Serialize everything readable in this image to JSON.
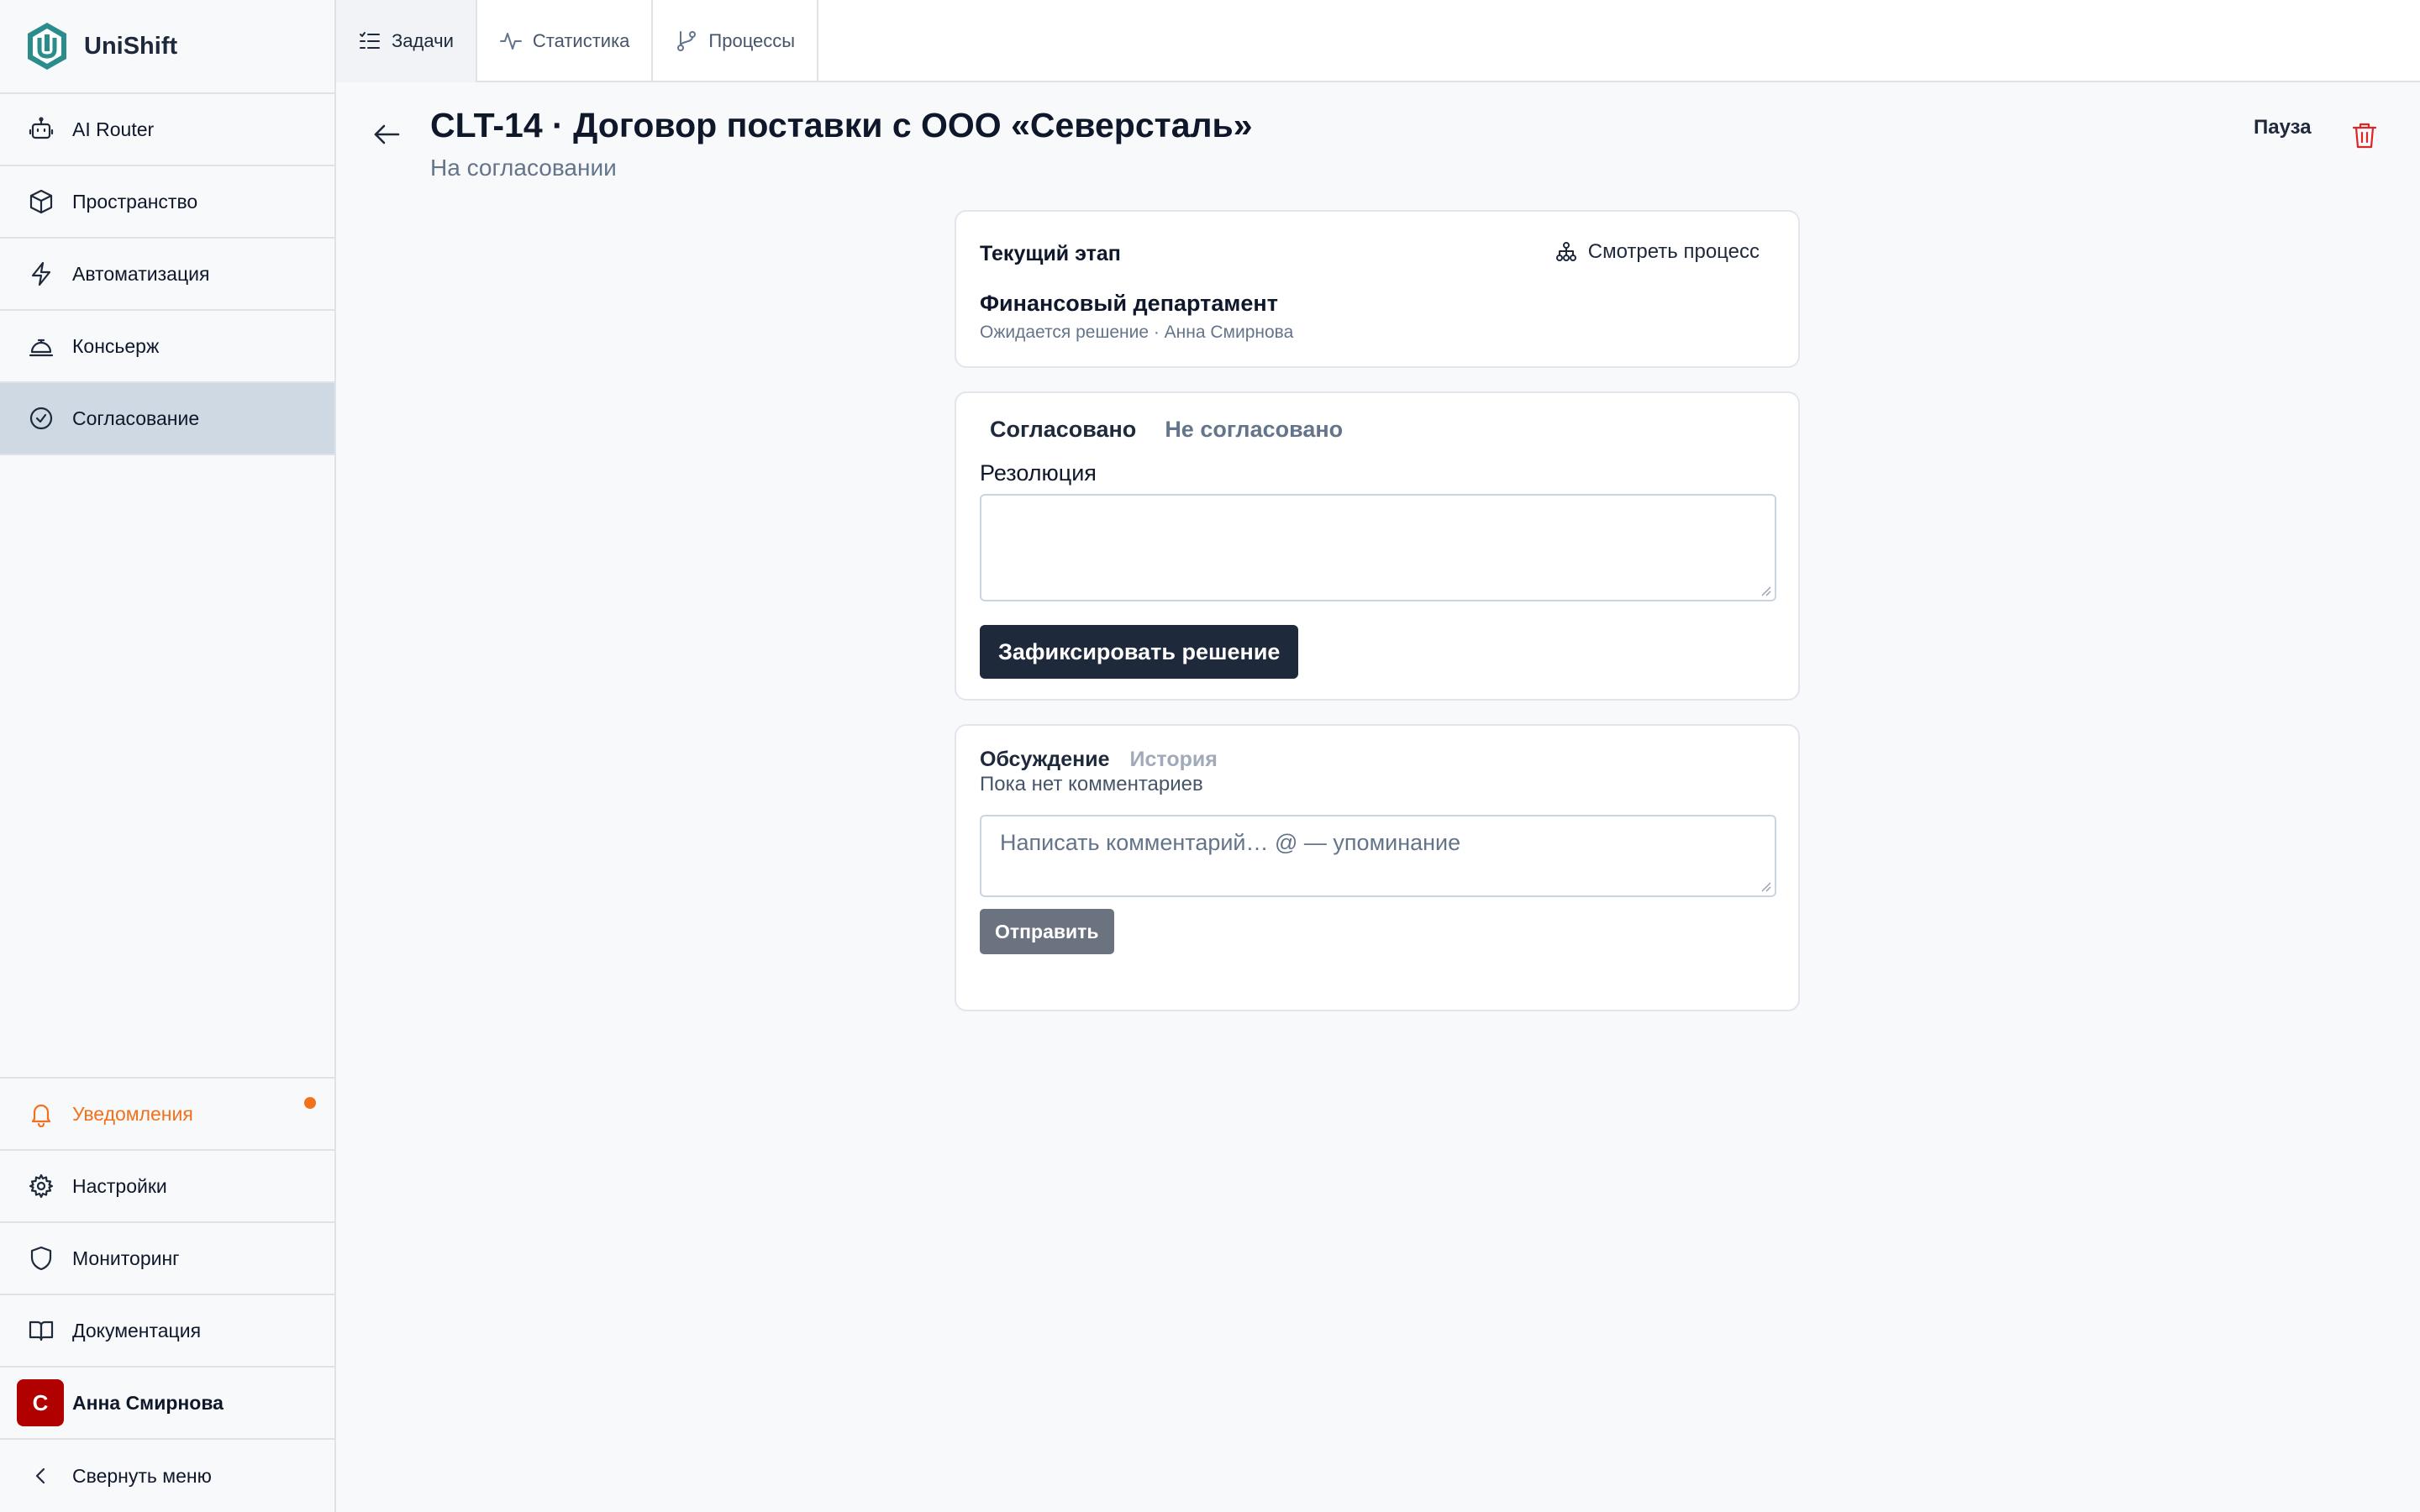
{
  "app": {
    "name": "UniShift"
  },
  "sidebar": {
    "items": [
      {
        "label": "AI Router",
        "icon": "bot-icon"
      },
      {
        "label": "Пространство",
        "icon": "cube-icon"
      },
      {
        "label": "Автоматизация",
        "icon": "bolt-icon"
      },
      {
        "label": "Консьерж",
        "icon": "bell-desk-icon"
      },
      {
        "label": "Согласование",
        "icon": "check-circle-icon",
        "active": true
      }
    ],
    "bottom": {
      "notifications": "Уведомления",
      "settings": "Настройки",
      "monitoring": "Мониторинг",
      "docs": "Документация",
      "user_initial": "С",
      "user_name": "Анна Смирнова",
      "collapse": "Свернуть меню"
    }
  },
  "tabs": [
    {
      "label": "Задачи",
      "active": true
    },
    {
      "label": "Статистика"
    },
    {
      "label": "Процессы"
    }
  ],
  "header": {
    "title": "CLT-14 · Договор поставки с ООО «Северсталь»",
    "status": "На согласовании",
    "pause": "Пауза"
  },
  "stage": {
    "label": "Текущий этап",
    "view_process": "Смотреть процесс",
    "name": "Финансовый департамент",
    "meta": "Ожидается решение · Анна Смирнова"
  },
  "decision": {
    "approved": "Согласовано",
    "rejected": "Не согласовано",
    "resolution_label": "Резолюция",
    "resolution_value": "",
    "submit": "Зафиксировать решение"
  },
  "discussion": {
    "tab_discussion": "Обсуждение",
    "tab_history": "История",
    "empty": "Пока нет комментариев",
    "placeholder": "Написать комментарий… @ — упоминание",
    "send": "Отправить"
  },
  "colors": {
    "accent_dark": "#1e293b",
    "notification": "#f2711c",
    "danger": "#dc2626",
    "avatar": "#b00000",
    "active_nav": "#cfd9e4"
  }
}
